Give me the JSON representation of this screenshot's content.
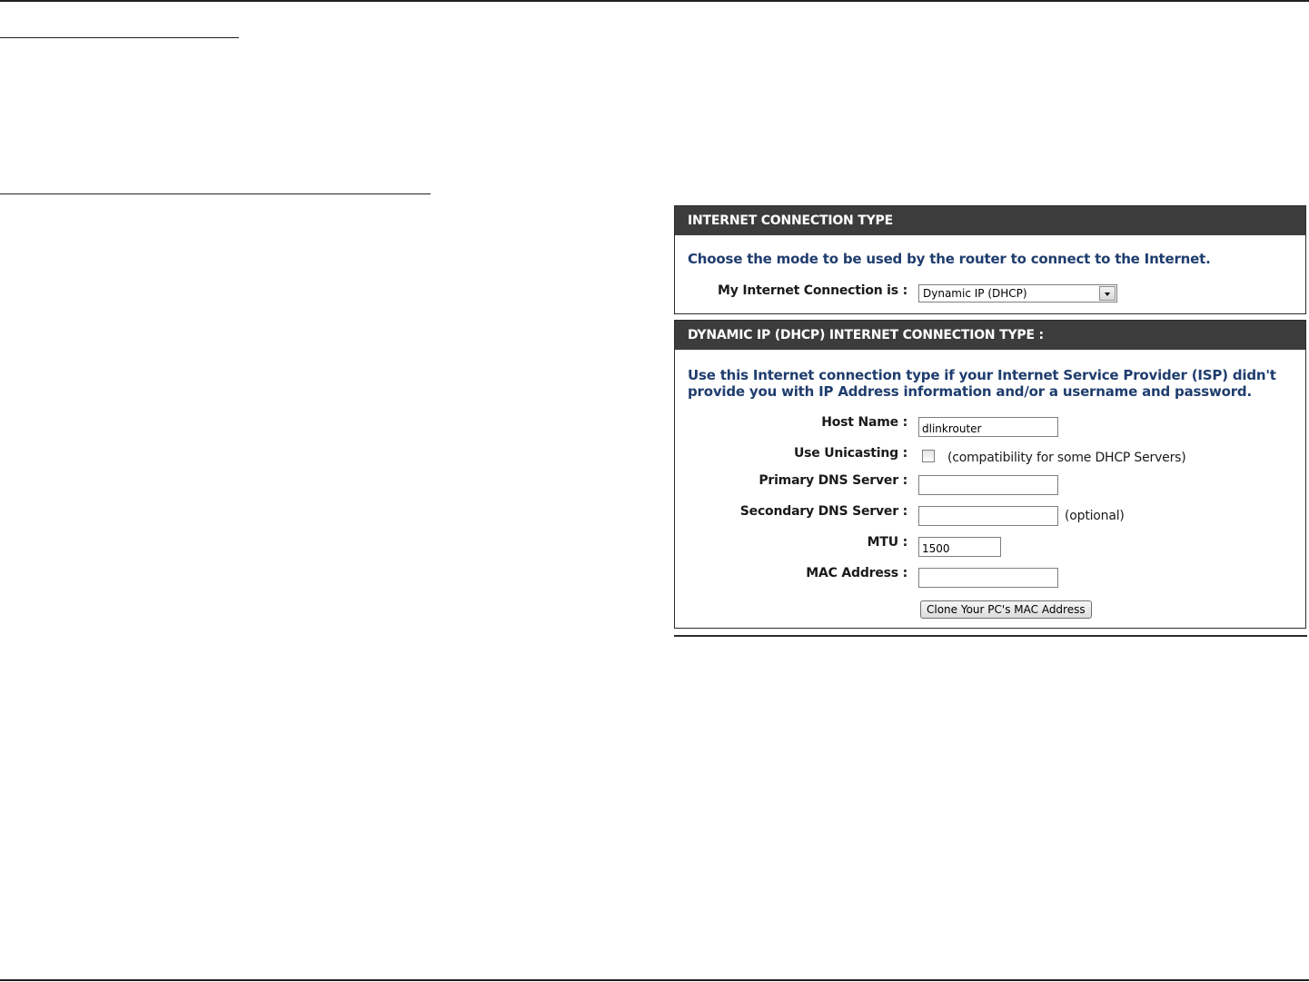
{
  "panel_connection_type": {
    "header": "INTERNET CONNECTION TYPE",
    "description": "Choose the mode to be used by the router to connect to the Internet.",
    "mode_label": "My Internet Connection is :",
    "mode_selected": "Dynamic IP (DHCP)"
  },
  "panel_dhcp": {
    "header": "DYNAMIC IP (DHCP) INTERNET CONNECTION TYPE :",
    "description_line1": "Use this Internet connection type if your Internet Service Provider (ISP) didn't",
    "description_line2": "provide you with IP Address information and/or a username and password.",
    "host_name": {
      "label": "Host Name :",
      "value": "dlinkrouter"
    },
    "use_unicasting": {
      "label": "Use Unicasting :",
      "checked": false,
      "note": "(compatibility for some DHCP Servers)"
    },
    "primary_dns": {
      "label": "Primary DNS Server :",
      "value": ""
    },
    "secondary_dns": {
      "label": "Secondary DNS Server :",
      "value": "",
      "note": "(optional)"
    },
    "mtu": {
      "label": "MTU :",
      "value": "1500"
    },
    "mac_address": {
      "label": "MAC Address :",
      "value": ""
    },
    "clone_button": "Clone Your PC's MAC Address"
  }
}
